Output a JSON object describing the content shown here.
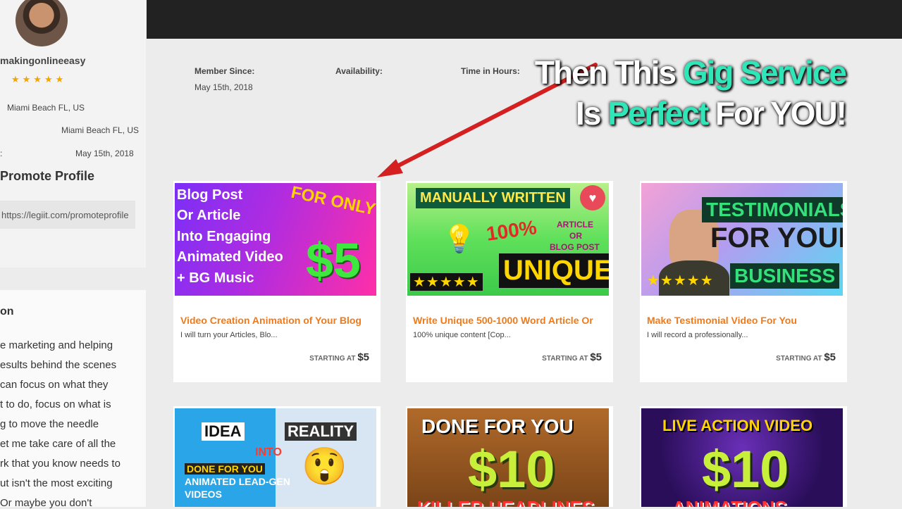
{
  "sidebar": {
    "username": "makingonlineeasy",
    "rating_stars": "★★★★★",
    "location_top": "Miami Beach FL, US",
    "location_right": "Miami Beach FL, US",
    "colon_left": ":",
    "date_right": "May 15th, 2018",
    "promote_title": "Promote Profile",
    "promote_url": "https://legiit.com/promoteprofile",
    "about_title": "on",
    "about_lines": [
      "e marketing and helping",
      "esults behind the scenes",
      "can focus on what they",
      "t to do, focus on what is",
      "g to move the needle",
      "et me take care of all the",
      "rk that you know needs to",
      "ut isn't the most exciting",
      "Or maybe you don't"
    ]
  },
  "meta": {
    "member_since_label": "Member Since:",
    "member_since_value": "May 15th, 2018",
    "availability_label": "Availability:",
    "time_label": "Time in Hours:"
  },
  "overlay": {
    "line1_a": "Then This ",
    "line1_b": "Gig Service",
    "line2_a": "Is ",
    "line2_b": "Perfect",
    "line2_c": " For YOU!"
  },
  "cards": [
    {
      "title": "Video Creation Animation of Your Blog",
      "desc": "I will turn your Articles, Blo...",
      "starting_label": "STARTING AT",
      "price": "$5",
      "thumb": {
        "l1": "Blog Post",
        "l2": "Or Article",
        "l3": "Into Engaging",
        "l4": "Animated Video",
        "l5": "+ BG Music",
        "tag": "FOR ONLY",
        "big": "$5"
      }
    },
    {
      "title": "Write Unique 500-1000 Word Article Or",
      "desc": "100% unique content [Cop...",
      "starting_label": "STARTING AT",
      "price": "$5",
      "thumb": {
        "banner": "MANUALLY WRITTEN",
        "pct": "100%",
        "side1": "ARTICLE",
        "side2": "OR",
        "side3": "BLOG POST",
        "big": "UNIQUE",
        "stars": "★★★★★"
      }
    },
    {
      "title": "Make Testimonial Video For You",
      "desc": "I will record a professionally...",
      "starting_label": "STARTING AT",
      "price": "$5",
      "thumb": {
        "l1": "TESTIMONIALS",
        "l2": "FOR YOUR",
        "l3": "BUSINESS",
        "stars": "★★★★★"
      }
    }
  ],
  "thumbs_row2": [
    {
      "a": "IDEA",
      "b": "REALITY",
      "c": "INTO",
      "d": "DONE FOR YOU",
      "e": "ANIMATED LEAD-GEN",
      "f": "VIDEOS"
    },
    {
      "a": "DONE FOR YOU",
      "b": "$10",
      "c": "KILLER HEADLINES"
    },
    {
      "a": "LIVE ACTION VIDEO",
      "b": "$10",
      "c": "ANIMATIONS"
    }
  ],
  "colors": {
    "accent": "#f07a1a",
    "overlay_highlight": "#2ee6b8",
    "arrow": "#d42020"
  }
}
